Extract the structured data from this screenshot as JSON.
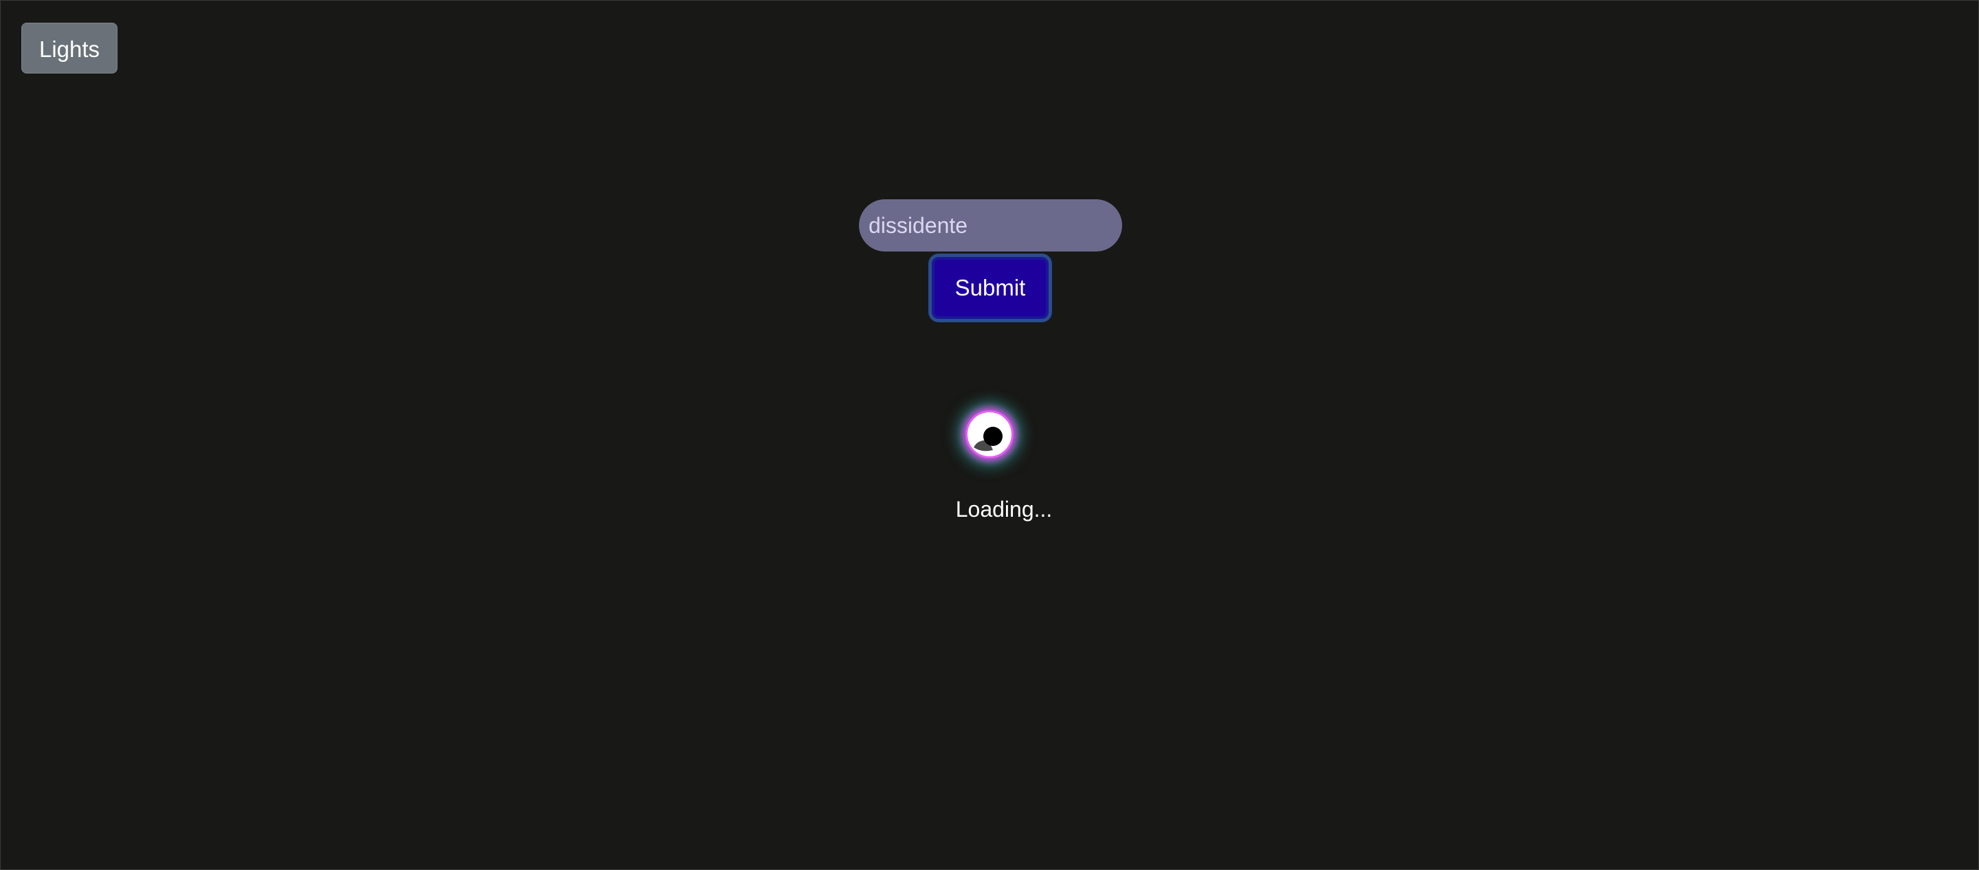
{
  "toolbar": {
    "lights_label": "Lights"
  },
  "search": {
    "value": "dissidente",
    "submit_label": "Submit"
  },
  "status": {
    "loading_text": "Loading..."
  },
  "icons": {
    "spinner": "loading-spinner-icon"
  },
  "colors": {
    "background": "#181816",
    "lights_button": "#6a7178",
    "input_background": "#6b6a8c",
    "submit_button": "#1e009c",
    "submit_focus_ring": "#2a4d8e",
    "spinner_glow_pink": "#e060f0",
    "spinner_glow_teal": "#3cdcd2"
  }
}
